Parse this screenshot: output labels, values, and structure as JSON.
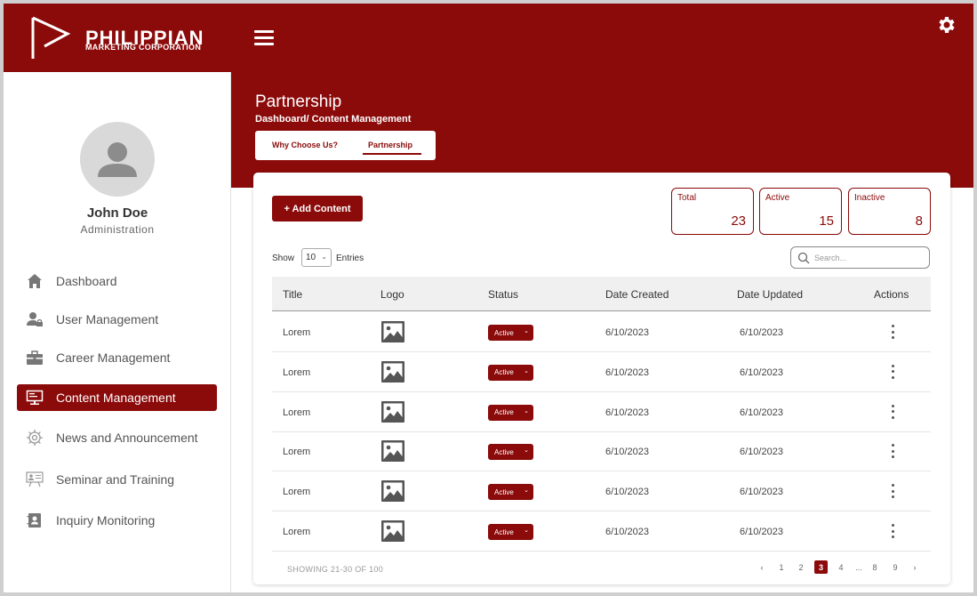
{
  "brand": {
    "title": "PHILIPPIAN",
    "subtitle": "MARKETING CORPORATION",
    "color": "#8b0a0a"
  },
  "header": {
    "menu_icon": "hamburger-icon",
    "settings_icon": "gear-icon"
  },
  "user": {
    "name": "John Doe",
    "role": "Administration"
  },
  "sidebar": {
    "items": [
      {
        "label": "Dashboard",
        "icon": "home-icon",
        "active": false
      },
      {
        "label": "User Management",
        "icon": "user-lock-icon",
        "active": false
      },
      {
        "label": "Career Management",
        "icon": "briefcase-icon",
        "active": false
      },
      {
        "label": "Content Management",
        "icon": "monitor-icon",
        "active": true
      },
      {
        "label": "News and Announcement",
        "icon": "gear-outline-icon",
        "active": false
      },
      {
        "label": "Seminar and Training",
        "icon": "presentation-icon",
        "active": false
      },
      {
        "label": "Inquiry Monitoring",
        "icon": "contact-icon",
        "active": false
      }
    ]
  },
  "page": {
    "title": "Partnership",
    "breadcrumb": "Dashboard/ Content Management",
    "tabs": [
      {
        "label": "Why Choose Us?",
        "active": false
      },
      {
        "label": "Partnership",
        "active": true
      }
    ]
  },
  "toolbar": {
    "add_label": "+  Add Content",
    "show_label": "Show",
    "entries_value": "10",
    "entries_label": "Entries",
    "search_placeholder": "Search..."
  },
  "stats": [
    {
      "label": "Total",
      "value": "23"
    },
    {
      "label": "Active",
      "value": "15"
    },
    {
      "label": "Inactive",
      "value": "8"
    }
  ],
  "table": {
    "headers": [
      "Title",
      "Logo",
      "Status",
      "Date Created",
      "Date Updated",
      "Actions"
    ],
    "rows": [
      {
        "title": "Lorem",
        "status": "Active",
        "created": "6/10/2023",
        "updated": "6/10/2023"
      },
      {
        "title": "Lorem",
        "status": "Active",
        "created": "6/10/2023",
        "updated": "6/10/2023"
      },
      {
        "title": "Lorem",
        "status": "Active",
        "created": "6/10/2023",
        "updated": "6/10/2023"
      },
      {
        "title": "Lorem",
        "status": "Active",
        "created": "6/10/2023",
        "updated": "6/10/2023"
      },
      {
        "title": "Lorem",
        "status": "Active",
        "created": "6/10/2023",
        "updated": "6/10/2023"
      },
      {
        "title": "Lorem",
        "status": "Active",
        "created": "6/10/2023",
        "updated": "6/10/2023"
      }
    ]
  },
  "pagination": {
    "summary": "SHOWING 21-30 OF 100",
    "prev": "‹",
    "next": "›",
    "pages": [
      "1",
      "2",
      "3",
      "4",
      "...",
      "8",
      "9"
    ],
    "current": "3"
  }
}
